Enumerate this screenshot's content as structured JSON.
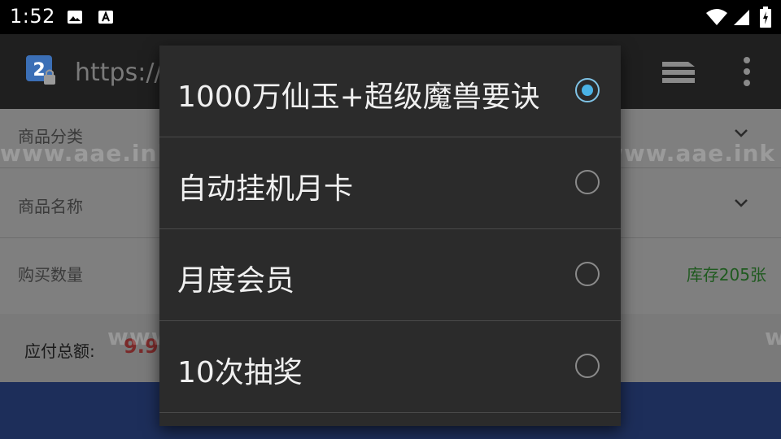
{
  "status_bar": {
    "time": "1:52"
  },
  "toolbar": {
    "url": "https://"
  },
  "form": {
    "category_label": "商品分类",
    "name_label": "商品名称",
    "quantity_label": "购买数量",
    "stock": "库存205张",
    "total_label": "应付总额:",
    "total_amount": "9.9"
  },
  "watermark": "www.aae.ink",
  "dialog": {
    "options": [
      {
        "label": "1000万仙玉+超级魔兽要诀",
        "selected": true
      },
      {
        "label": "自动挂机月卡",
        "selected": false
      },
      {
        "label": "月度会员",
        "selected": false
      },
      {
        "label": "10次抽奖",
        "selected": false
      }
    ]
  },
  "colors": {
    "accent": "#4ab3e6",
    "dialog_bg": "#2b2b2b",
    "stock_green": "#1f5a1f"
  }
}
